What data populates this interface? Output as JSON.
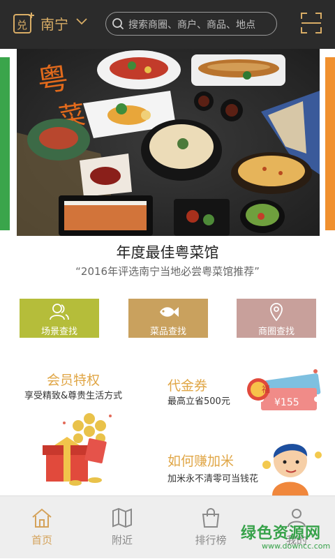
{
  "header": {
    "logo_icon": "coupon-logo-icon",
    "city": "南宁",
    "search_placeholder": "搜索商圈、商户、商品、地点",
    "scan_icon": "scan-icon",
    "bg_color": "#2b2b2b",
    "accent_color": "#d9ad66"
  },
  "banner": {
    "image_description_icon": "cantonese-food-banner",
    "calligraphy": "粤菜",
    "title": "年度最佳粤菜馆",
    "subtitle": "“2016年评选南宁当地必尝粤菜馆推荐”"
  },
  "quick_actions": [
    {
      "label": "场景查找",
      "icon": "people-icon",
      "color": "#b5bd3a"
    },
    {
      "label": "菜品查找",
      "icon": "fish-icon",
      "color": "#c9a15e"
    },
    {
      "label": "商圈查找",
      "icon": "location-pin-icon",
      "color": "#c8a09b"
    }
  ],
  "cards": {
    "membership": {
      "title": "会员特权",
      "subtitle": "享受精致&尊贵生活方式",
      "icon": "gift-box-icon"
    },
    "voucher": {
      "title": "代金券",
      "subtitle": "最高立省500元",
      "icon": "voucher-ticket-icon",
      "badge": "福",
      "amount": "¥155"
    },
    "earn": {
      "title": "如何赚加米",
      "subtitle": "加米永不清零可当钱花",
      "icon": "cartoon-man-icon"
    }
  },
  "tabs": [
    {
      "label": "首页",
      "icon": "home-icon",
      "active": true
    },
    {
      "label": "附近",
      "icon": "map-icon",
      "active": false
    },
    {
      "label": "排行榜",
      "icon": "shopping-bag-icon",
      "active": false
    },
    {
      "label": "我的",
      "icon": "user-icon",
      "active": false
    }
  ],
  "watermark": {
    "line1": "绿色资源网",
    "line2": "www.downcc.com"
  }
}
